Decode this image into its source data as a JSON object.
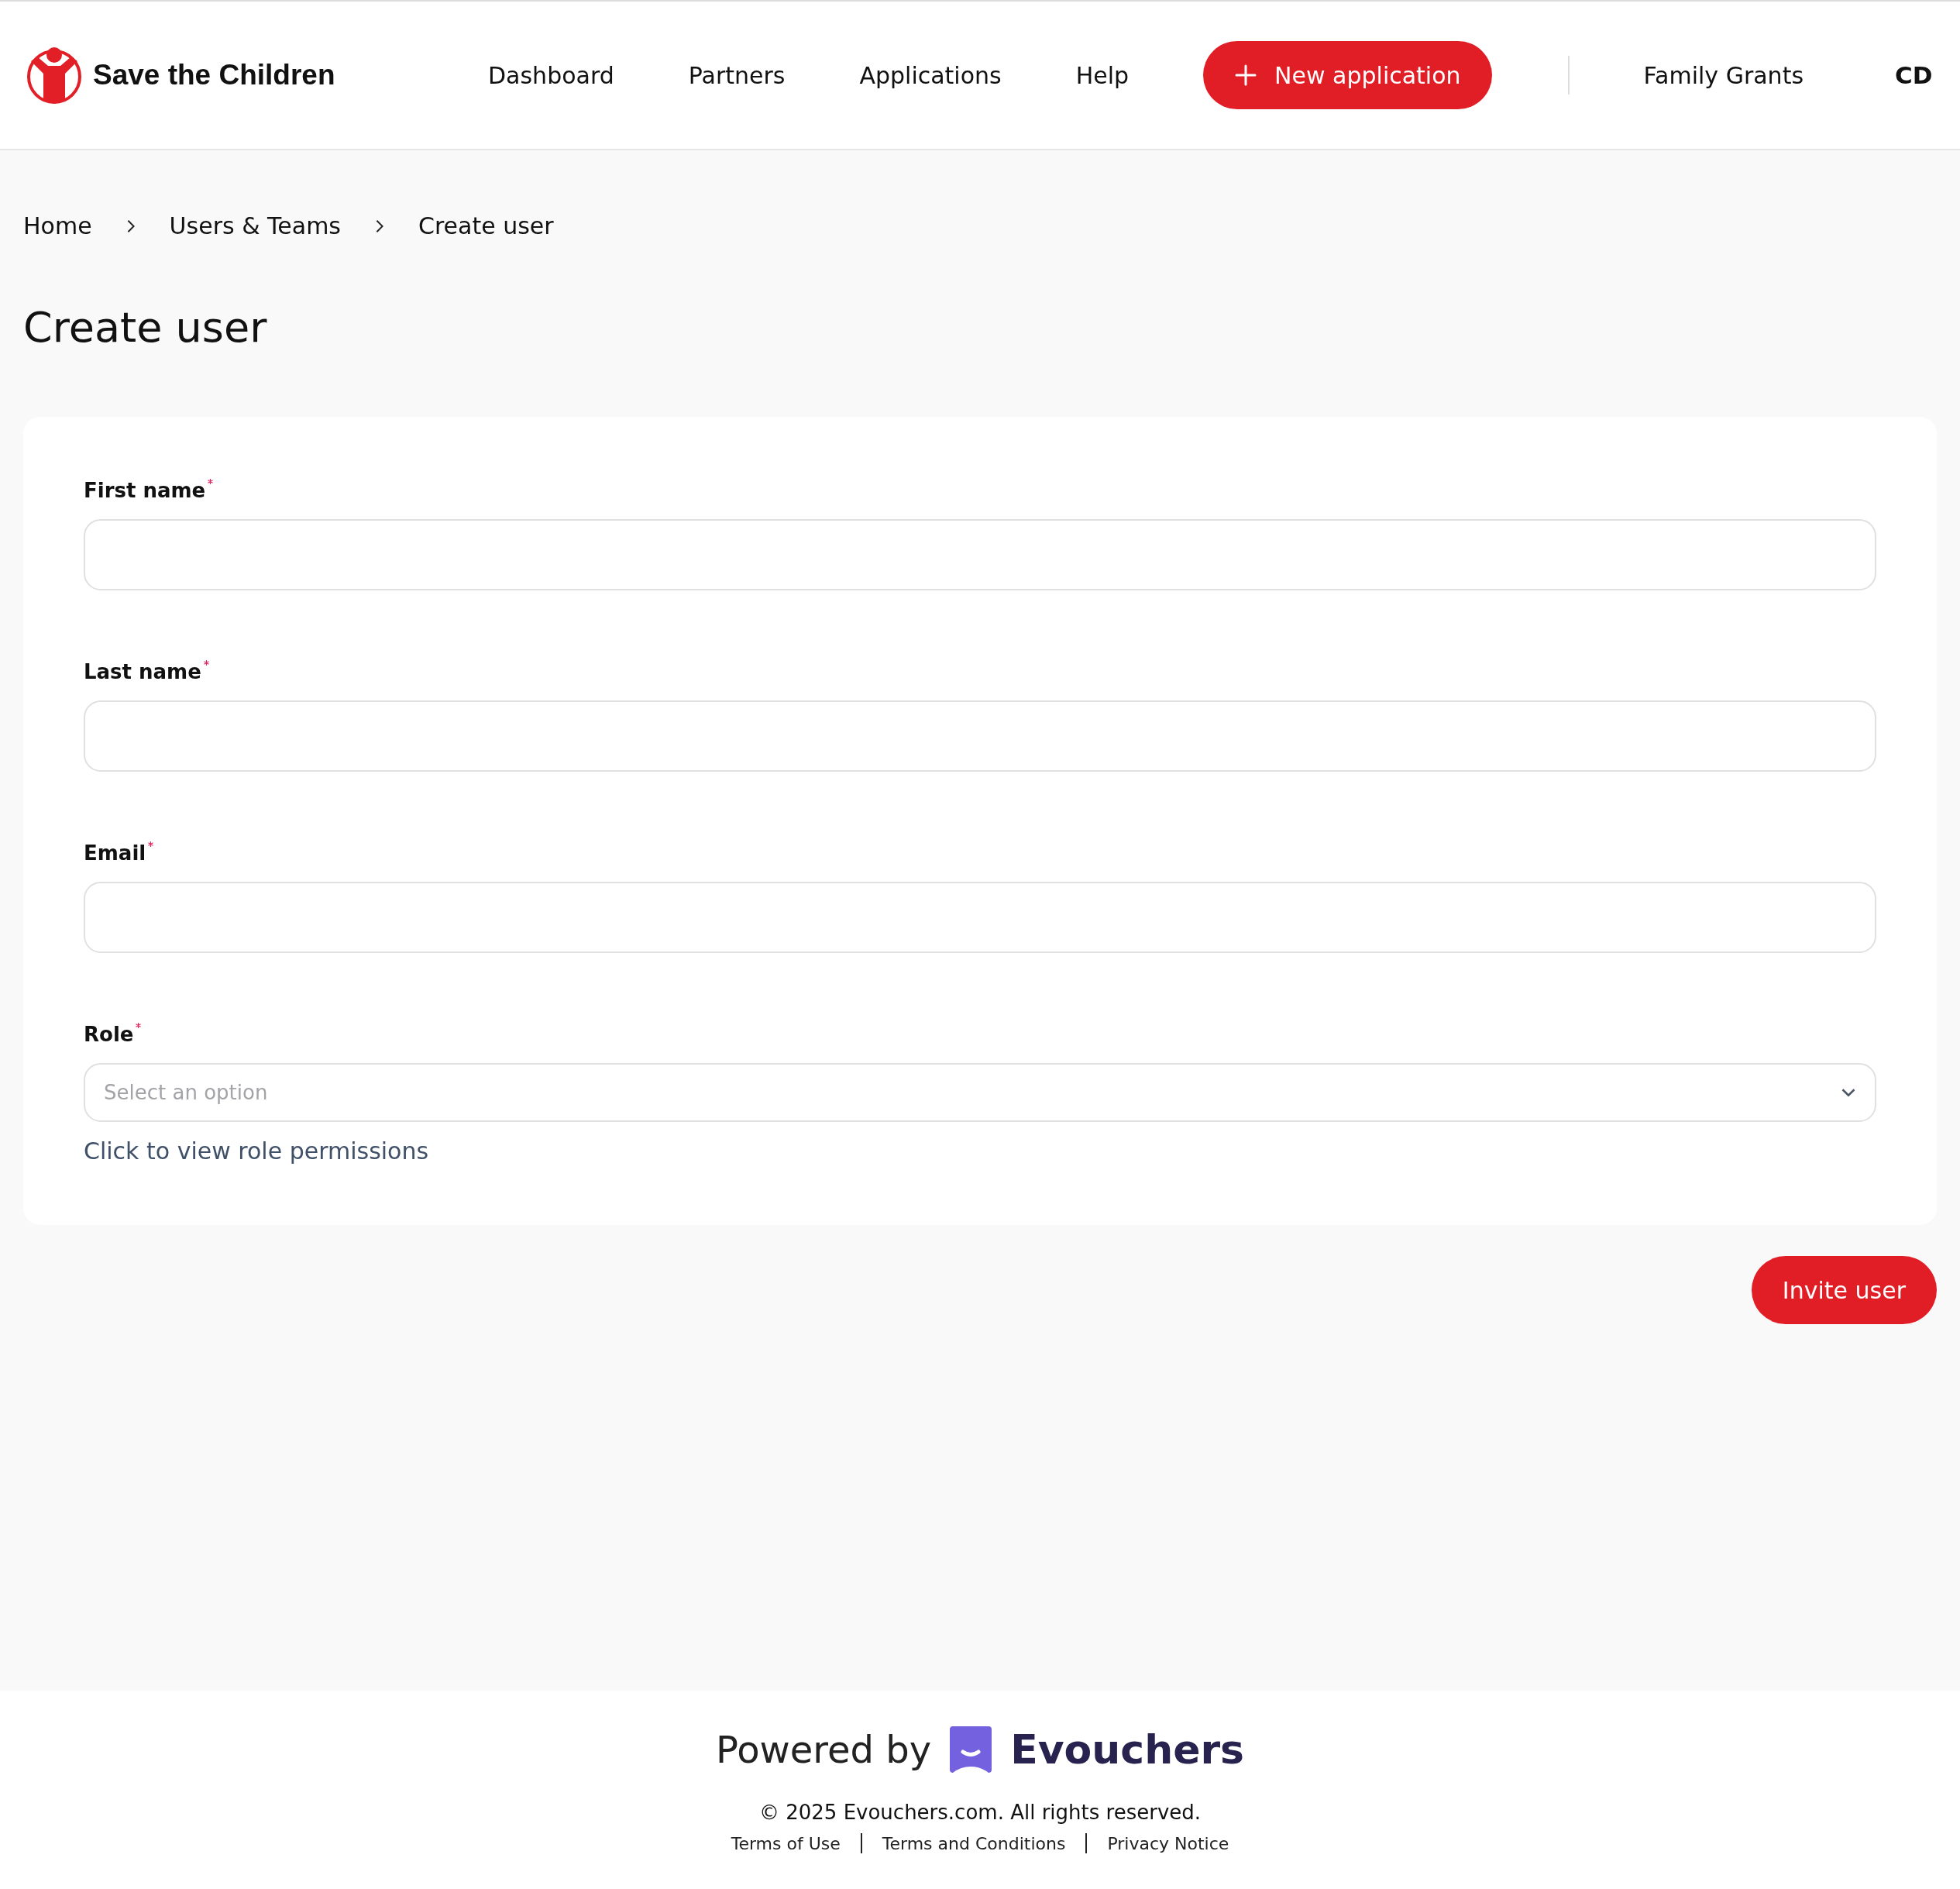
{
  "header": {
    "brand": "Save the Children",
    "nav": [
      {
        "label": "Dashboard"
      },
      {
        "label": "Partners"
      },
      {
        "label": "Applications"
      },
      {
        "label": "Help"
      }
    ],
    "new_button": "New application",
    "organisation": "Family Grants",
    "user_initials": "CD"
  },
  "breadcrumb": [
    {
      "label": "Home"
    },
    {
      "label": "Users & Teams"
    },
    {
      "label": "Create user"
    }
  ],
  "title": "Create user",
  "fields": [
    {
      "label": "First name",
      "required": true,
      "kind": "text"
    },
    {
      "label": "Last name",
      "required": true,
      "kind": "text"
    },
    {
      "label": "Email",
      "required": true,
      "kind": "text"
    },
    {
      "label": "Role",
      "required": true,
      "kind": "select",
      "placeholder": "Select an option",
      "help_link": "Click to view role permissions"
    }
  ],
  "submit_button": "Invite user",
  "footer": {
    "powered_by": "Powered by",
    "brand": "Evouchers",
    "copyright": "© 2025 Evouchers.com. All rights reserved.",
    "links": [
      "Terms of Use",
      "Terms and Conditions",
      "Privacy Notice"
    ]
  }
}
